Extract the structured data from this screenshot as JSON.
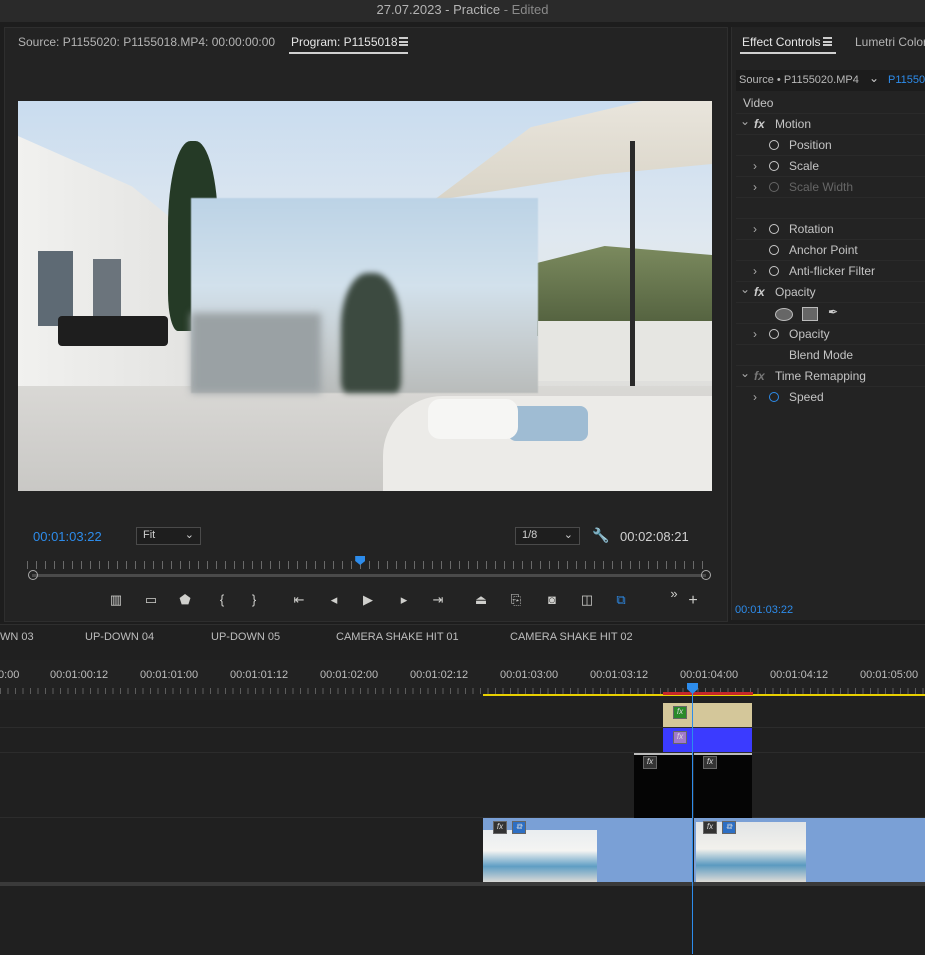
{
  "window": {
    "title": "27.07.2023 - Practice",
    "edited": "- Edited"
  },
  "source_monitor": {
    "source_tab": "Source: P1155020: P1155018.MP4: 00:00:00:00",
    "program_tab": "Program: P1155018",
    "current_time": "00:01:03:22",
    "zoom": "Fit",
    "resolution": "1/8",
    "duration": "00:02:08:21",
    "playhead_fraction": 0.49
  },
  "effect_controls": {
    "tab": "Effect Controls",
    "lumetri_tab": "Lumetri Color",
    "source_label": "Source • P1155020.MP4",
    "clip_label": "P11550",
    "section": "Video",
    "rows": [
      {
        "label": "Motion",
        "fx": true,
        "indent": 1,
        "expand": "open"
      },
      {
        "label": "Position",
        "stopwatch": true,
        "indent": 2
      },
      {
        "label": "Scale",
        "stopwatch": true,
        "indent": 2,
        "expand": "closed"
      },
      {
        "label": "Scale Width",
        "stopwatch": true,
        "indent": 2,
        "expand": "closed",
        "disabled": true
      },
      {
        "label": "",
        "indent": 2
      },
      {
        "label": "Rotation",
        "stopwatch": true,
        "indent": 2,
        "expand": "closed"
      },
      {
        "label": "Anchor Point",
        "stopwatch": true,
        "indent": 2
      },
      {
        "label": "Anti-flicker Filter",
        "stopwatch": true,
        "indent": 2,
        "expand": "closed"
      },
      {
        "label": "Opacity",
        "fx": true,
        "indent": 1,
        "expand": "open"
      },
      {
        "label": "",
        "shapes": true,
        "indent": 2
      },
      {
        "label": "Opacity",
        "stopwatch": true,
        "indent": 2,
        "expand": "closed"
      },
      {
        "label": "Blend Mode",
        "indent": 2
      },
      {
        "label": "Time Remapping",
        "fx": true,
        "indent": 1,
        "expand": "open",
        "disabled_fx": true
      },
      {
        "label": "Speed",
        "stopwatch": true,
        "stopwatch_active": true,
        "indent": 2,
        "expand": "closed"
      }
    ],
    "footer_time": "00:01:03:22"
  },
  "sequence_tabs": [
    "WN 03",
    "UP-DOWN 04",
    "UP-DOWN 05",
    "CAMERA SHAKE HIT 01",
    "CAMERA SHAKE HIT 02"
  ],
  "ruler_labels": [
    "0:00",
    "00:01:00:12",
    "00:01:01:00",
    "00:01:01:12",
    "00:01:02:00",
    "00:01:02:12",
    "00:01:03:00",
    "00:01:03:12",
    "00:01:04:00",
    "00:01:04:12",
    "00:01:05:00"
  ],
  "colors": {
    "accent": "#2d8ceb",
    "adjustment_clip": "#d4c79a",
    "blue_clip": "#3b3bff",
    "video_clip": "#7aa0d6",
    "work_area": "#e8d000",
    "render_red": "#c4262b"
  }
}
